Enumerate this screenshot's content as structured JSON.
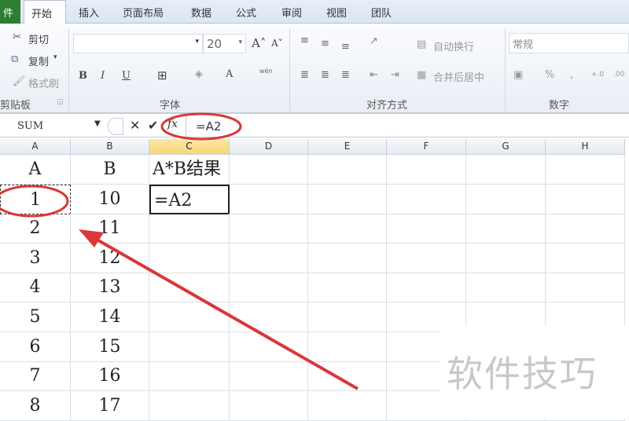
{
  "tabs": {
    "file": "件",
    "home": "开始",
    "insert": "插入",
    "layout": "页面布局",
    "data": "数据",
    "formulas": "公式",
    "review": "审阅",
    "view": "视图",
    "team": "团队"
  },
  "clipboard": {
    "cut": "剪切",
    "copy": "复制",
    "format_painter": "格式刷",
    "label": "剪贴板"
  },
  "font": {
    "name": "",
    "size": "20",
    "label": "字体",
    "bold": "B",
    "italic": "I",
    "underline": "U",
    "font_color": "A",
    "phonetic": "wén"
  },
  "alignment": {
    "wrap_text": "自动换行",
    "merge_center": "合并后居中",
    "label": "对齐方式"
  },
  "number": {
    "format": "常规",
    "percent": "%",
    "comma": ",",
    "inc_decimal": "+.0",
    "dec_decimal": ".00",
    "label": "数字"
  },
  "formula_bar": {
    "name_box": "SUM",
    "fx": "fx",
    "formula": "=A2"
  },
  "columns": [
    "A",
    "B",
    "C",
    "D",
    "E",
    "F",
    "G",
    "H"
  ],
  "rows": [
    [
      "A",
      "B",
      "A*B结果"
    ],
    [
      "1",
      "10",
      "=A2"
    ],
    [
      "2",
      "11",
      ""
    ],
    [
      "3",
      "12",
      ""
    ],
    [
      "4",
      "13",
      ""
    ],
    [
      "5",
      "14",
      ""
    ],
    [
      "6",
      "15",
      ""
    ],
    [
      "7",
      "16",
      ""
    ],
    [
      "8",
      "17",
      ""
    ]
  ],
  "watermark": "软件技巧",
  "colors": {
    "annotation": "#d9373a",
    "selected_header": "#f7d775",
    "file_tab": "#2e7d32"
  }
}
